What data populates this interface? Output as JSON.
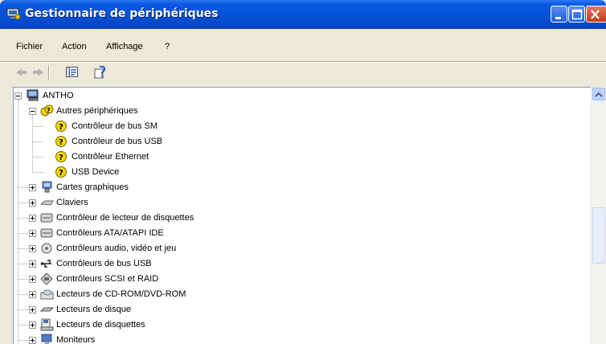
{
  "window": {
    "title": "Gestionnaire de périphériques",
    "buttons": {
      "minimize": "minimize-icon",
      "maximize": "maximize-icon",
      "close": "close-icon"
    }
  },
  "menu": {
    "items": [
      {
        "label": "Fichier"
      },
      {
        "label": "Action"
      },
      {
        "label": "Affichage"
      },
      {
        "label": "?"
      }
    ]
  },
  "toolbar": {
    "buttons": [
      "back-arrow-icon",
      "forward-arrow-icon",
      "properties-icon",
      "help-icon"
    ]
  },
  "tree": {
    "root": {
      "label": "ANTHO",
      "icon": "computer-icon",
      "expanded": true
    },
    "items": [
      {
        "label": "Autres périphériques",
        "icon": "unknown-device-icon",
        "level": 1,
        "expanded": true
      },
      {
        "label": "Contrôleur de bus SM",
        "icon": "unknown-device-icon",
        "level": 2
      },
      {
        "label": "Contrôleur de bus USB",
        "icon": "unknown-device-icon",
        "level": 2
      },
      {
        "label": "Contrôleur Ethernet",
        "icon": "unknown-device-icon",
        "level": 2
      },
      {
        "label": "USB Device",
        "icon": "unknown-device-icon",
        "level": 2
      },
      {
        "label": "Cartes graphiques",
        "icon": "display-adapter-icon",
        "level": 1,
        "expanded": false
      },
      {
        "label": "Claviers",
        "icon": "keyboard-icon",
        "level": 1,
        "expanded": false
      },
      {
        "label": "Contrôleur de lecteur de disquettes",
        "icon": "floppy-controller-icon",
        "level": 1,
        "expanded": false
      },
      {
        "label": "Contrôleurs ATA/ATAPI IDE",
        "icon": "ide-controller-icon",
        "level": 1,
        "expanded": false
      },
      {
        "label": "Contrôleurs audio, vidéo et jeu",
        "icon": "audio-icon",
        "level": 1,
        "expanded": false
      },
      {
        "label": "Contrôleurs de bus USB",
        "icon": "usb-icon",
        "level": 1,
        "expanded": false
      },
      {
        "label": "Contrôleurs SCSI et RAID",
        "icon": "scsi-icon",
        "level": 1,
        "expanded": false
      },
      {
        "label": "Lecteurs de CD-ROM/DVD-ROM",
        "icon": "cdrom-icon",
        "level": 1,
        "expanded": false
      },
      {
        "label": "Lecteurs de disque",
        "icon": "disk-drive-icon",
        "level": 1,
        "expanded": false
      },
      {
        "label": "Lecteurs de disquettes",
        "icon": "floppy-drive-icon",
        "level": 1,
        "expanded": false
      },
      {
        "label": "Moniteurs",
        "icon": "monitor-icon",
        "level": 1,
        "expanded": false
      }
    ]
  },
  "colors": {
    "titlebar": "#0552D8",
    "face": "#ECE9D8",
    "close": "#C5391B"
  }
}
